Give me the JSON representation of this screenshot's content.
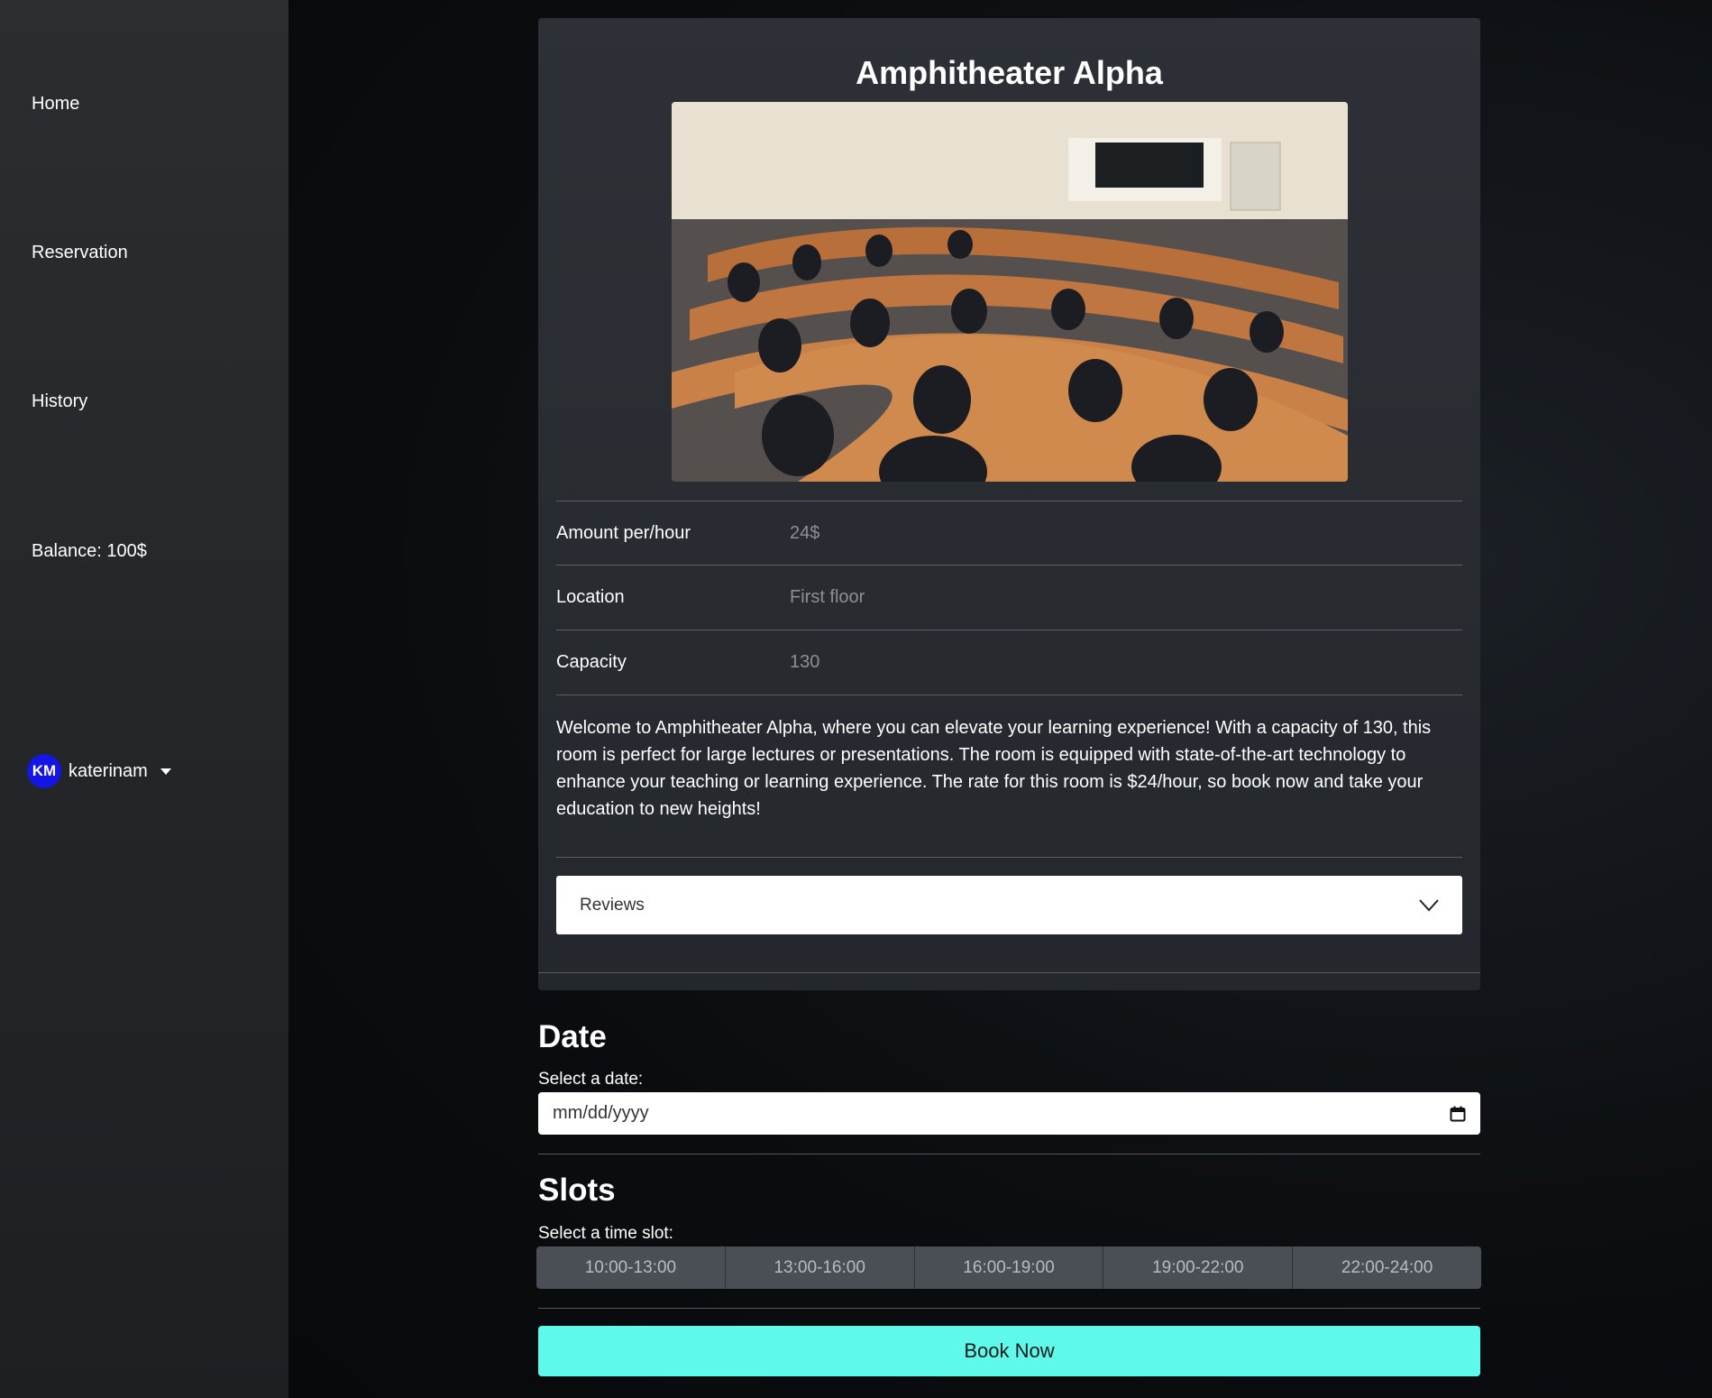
{
  "sidebar": {
    "items": [
      {
        "label": "Home"
      },
      {
        "label": "Reservation"
      },
      {
        "label": "History"
      }
    ],
    "balance": "Balance: 100$",
    "user": {
      "initials": "KM",
      "name": "katerinam"
    }
  },
  "room": {
    "title": "Amphitheater Alpha",
    "details": [
      {
        "label": "Amount per/hour",
        "value": "24$"
      },
      {
        "label": "Location",
        "value": "First floor"
      },
      {
        "label": "Capacity",
        "value": "130"
      }
    ],
    "description": "Welcome to Amphitheater Alpha, where you can elevate your learning experience! With a capacity of 130, this room is perfect for large lectures or presentations. The room is equipped with state-of-the-art technology to enhance your teaching or learning experience. The rate for this room is $24/hour, so book now and take your education to new heights!",
    "reviews_label": "Reviews"
  },
  "date": {
    "title": "Date",
    "label": "Select a date:",
    "placeholder": "mm/dd/yyyy"
  },
  "slots": {
    "title": "Slots",
    "label": "Select a time slot:",
    "options": [
      "10:00-13:00",
      "13:00-16:00",
      "16:00-19:00",
      "19:00-22:00",
      "22:00-24:00"
    ]
  },
  "book_button": "Book Now",
  "colors": {
    "accent": "#5ff9ec",
    "avatar": "#1515e8",
    "slot_bg": "#4a4f56"
  }
}
